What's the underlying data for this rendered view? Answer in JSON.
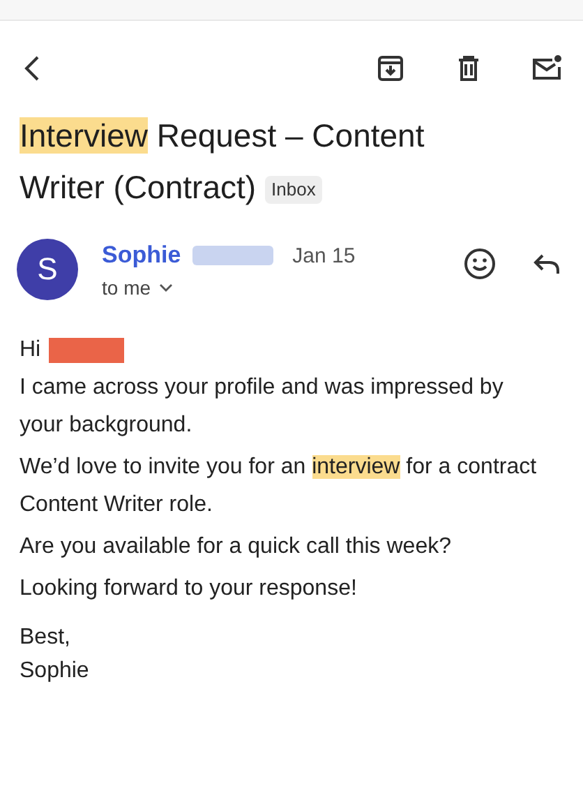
{
  "toolbar": {
    "actions": [
      {
        "kind": "archive"
      },
      {
        "kind": "delete"
      },
      {
        "kind": "mark-unread"
      }
    ]
  },
  "subject": {
    "segments": [
      {
        "text": "Interview",
        "highlighted": true
      },
      {
        "text": " Request – Content Writer (Contract)",
        "highlighted": false
      }
    ],
    "label": "Inbox"
  },
  "message": {
    "avatar": "S",
    "sender": "Sophie",
    "sender_surname_redacted": true,
    "date": "Jan 15",
    "recipient": "to me",
    "greeting": {
      "text": "Hi",
      "name_redacted": true
    },
    "paragraphs": [
      [
        {
          "text": "I came across your profile and was impressed by your background.",
          "highlighted": false
        }
      ],
      [
        {
          "text": "We’d love to invite you for an ",
          "highlighted": false
        },
        {
          "text": "interview",
          "highlighted": true
        },
        {
          "text": " for a contract Content Writer role.",
          "highlighted": false
        }
      ],
      [
        {
          "text": "Are you available for a quick call this week?",
          "highlighted": false
        }
      ],
      [
        {
          "text": "Looking forward to your response!",
          "highlighted": false
        }
      ]
    ],
    "signoff": [
      "Best,",
      "Sophie"
    ]
  }
}
